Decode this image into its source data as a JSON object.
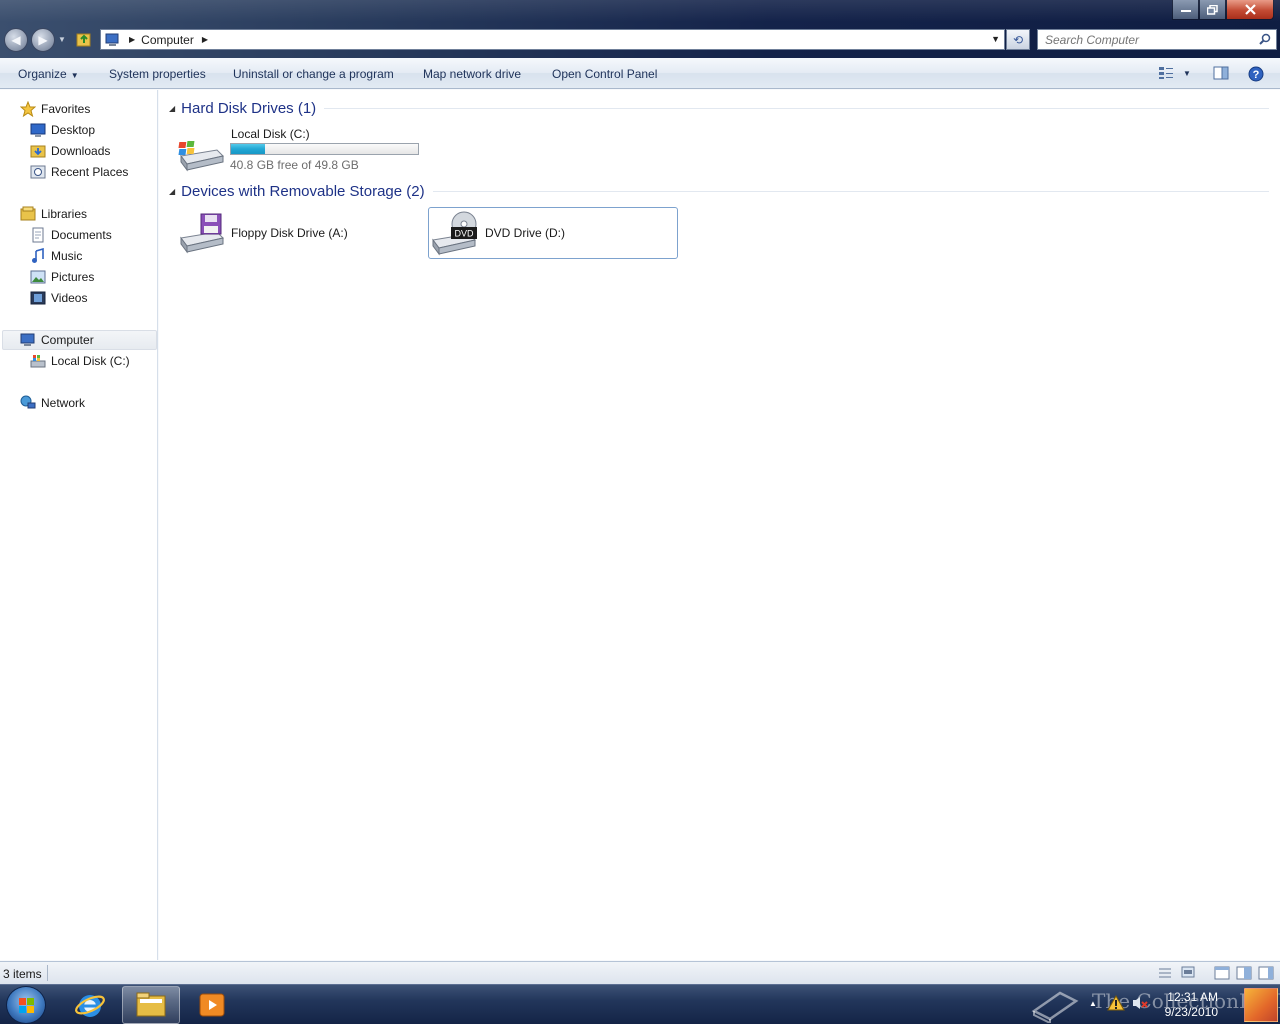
{
  "address": {
    "path": "Computer"
  },
  "search": {
    "placeholder": "Search Computer"
  },
  "toolbar": {
    "organize": "Organize",
    "system_properties": "System properties",
    "uninstall": "Uninstall or change a program",
    "map_network": "Map network drive",
    "open_control_panel": "Open Control Panel"
  },
  "nav": {
    "favorites": "Favorites",
    "desktop": "Desktop",
    "downloads": "Downloads",
    "recent_places": "Recent Places",
    "libraries": "Libraries",
    "documents": "Documents",
    "music": "Music",
    "pictures": "Pictures",
    "videos": "Videos",
    "computer": "Computer",
    "local_disk": "Local Disk (C:)",
    "network": "Network"
  },
  "content": {
    "hard_disk_header": "Hard Disk Drives (1)",
    "removable_header": "Devices with Removable Storage (2)",
    "local_disk": {
      "label": "Local Disk (C:)",
      "free": "40.8 GB free of 49.8 GB",
      "used_fraction": 0.18
    },
    "floppy": {
      "label": "Floppy Disk Drive (A:)"
    },
    "dvd": {
      "label": "DVD Drive (D:)",
      "badge": "DVD"
    }
  },
  "status": {
    "items": "3 items"
  },
  "taskbar": {
    "time": "12:31 AM",
    "date": "9/23/2010",
    "watermark": "The CollectionBook"
  },
  "colors": {
    "group_header": "#1e3287",
    "capacity_fill": "#22a7d4",
    "selection_border": "#7da2ce"
  }
}
